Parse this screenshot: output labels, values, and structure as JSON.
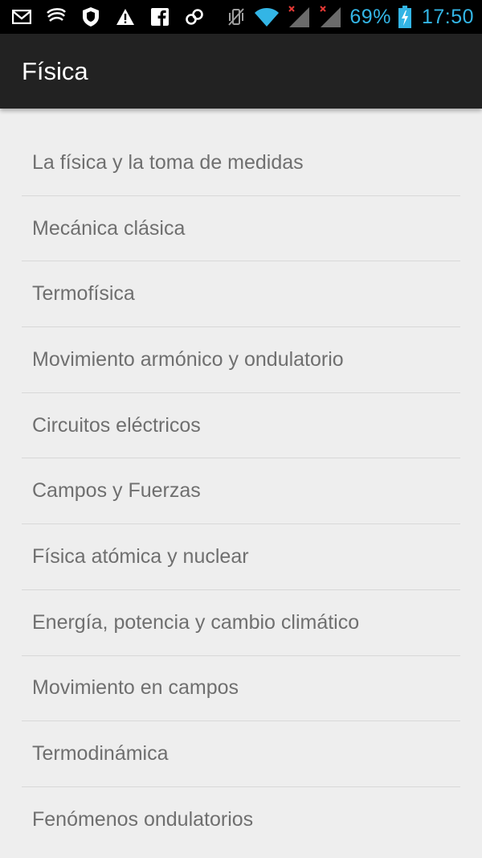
{
  "status_bar": {
    "icons_left": [
      "gmail-icon",
      "swirl-app-icon",
      "shield-icon",
      "warning-icon",
      "facebook-icon",
      "link-icon"
    ],
    "icons_right": [
      "vibrate-icon",
      "wifi-icon",
      "signal-icon",
      "signal-icon",
      "battery-icon"
    ],
    "battery_percent": "69%",
    "time": "17:50",
    "accent_color": "#33b5e5"
  },
  "action_bar": {
    "title": "Física"
  },
  "topics": [
    {
      "label": "La física y la toma de medidas"
    },
    {
      "label": "Mecánica clásica"
    },
    {
      "label": "Termofísica"
    },
    {
      "label": "Movimiento armónico y ondulatorio"
    },
    {
      "label": "Circuitos eléctricos"
    },
    {
      "label": "Campos y Fuerzas"
    },
    {
      "label": "Física atómica y nuclear"
    },
    {
      "label": "Energía, potencia y cambio climático"
    },
    {
      "label": "Movimiento en campos"
    },
    {
      "label": "Termodinámica"
    },
    {
      "label": "Fenómenos ondulatorios"
    }
  ]
}
